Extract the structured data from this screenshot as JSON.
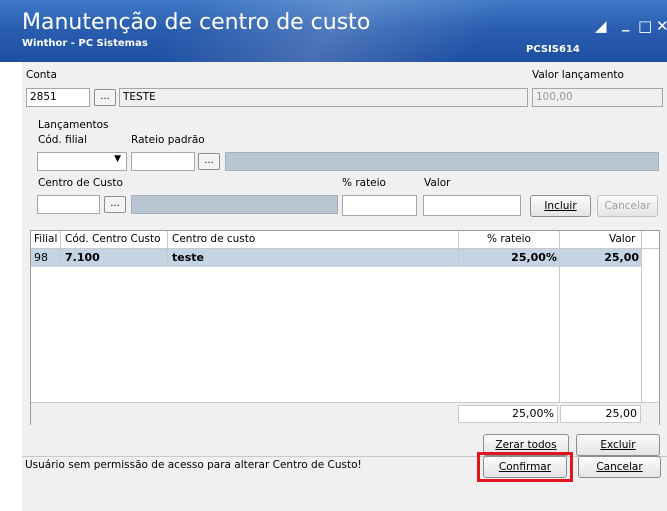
{
  "window": {
    "title": "Manutenção de centro de custo",
    "subtitle": "Winthor - PC Sistemas",
    "program_code": "PCSIS614"
  },
  "conta": {
    "label": "Conta",
    "code": "2851",
    "lookup_label": "...",
    "name": "TESTE"
  },
  "valor_lancamento": {
    "label": "Valor lançamento",
    "value": "100,00"
  },
  "lancamentos": {
    "group_label": "Lançamentos",
    "cod_filial_label": "Cód. filial",
    "rateio_padrao_label": "Rateio padrão",
    "rateio_lookup_label": "...",
    "centro_custo_label": "Centro de Custo",
    "centro_lookup_label": "...",
    "pct_rateio_label": "% rateio",
    "valor_label": "Valor",
    "incluir_label": "Incluir",
    "cancelar_label": "Cancelar"
  },
  "grid": {
    "columns": [
      "Filial",
      "Cód. Centro Custo",
      "Centro de custo",
      "% rateio",
      "Valor"
    ],
    "rows": [
      {
        "filial": "98",
        "cod": "7.100",
        "centro": "teste",
        "pct": "25,00%",
        "valor": "25,00"
      }
    ],
    "footer": {
      "pct": "25,00%",
      "valor": "25,00"
    }
  },
  "actions": {
    "zerar_label": "Zerar todos",
    "excluir_label": "Excluir",
    "confirmar_label": "Confirmar",
    "cancelar_label": "Cancelar"
  },
  "status": {
    "message": "Usuário sem permissão de acesso para alterar Centro de Custo!"
  },
  "colors": {
    "titlebar": "#2a5eb0",
    "selected_row": "#c5d4e3",
    "highlight_box": "#e0141e"
  }
}
